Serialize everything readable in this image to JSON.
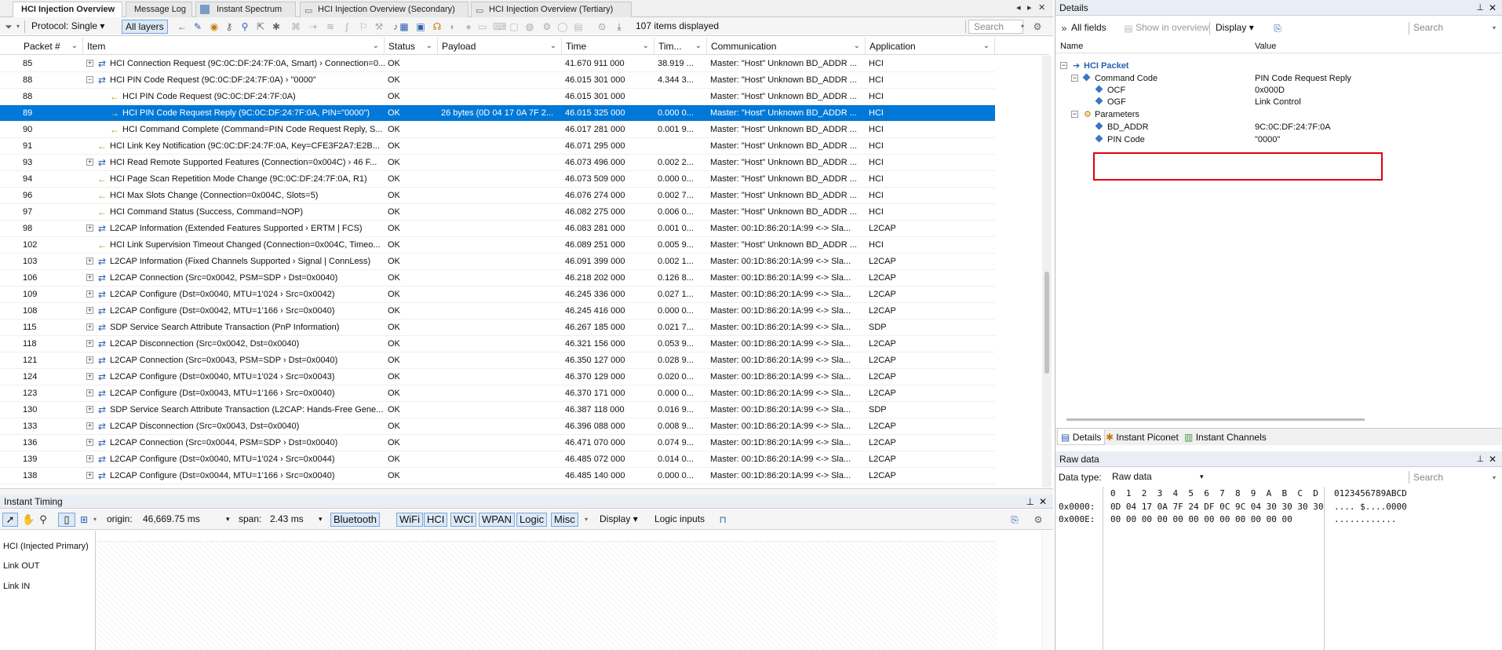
{
  "tabs": [
    {
      "label": "HCI Injection Overview",
      "active": true
    },
    {
      "label": "Message Log"
    },
    {
      "label": "Instant Spectrum"
    },
    {
      "label": "HCI Injection Overview (Secondary)"
    },
    {
      "label": "HCI Injection Overview (Tertiary)"
    }
  ],
  "toolbar": {
    "protocol": "Protocol: Single",
    "all_layers": "All layers",
    "items_displayed": "107 items displayed",
    "search_placeholder": "Search"
  },
  "columns": [
    "Packet #",
    "Item",
    "Status",
    "Payload",
    "Time",
    "Tim...",
    "Communication",
    "Application"
  ],
  "rows": [
    {
      "packet": "85",
      "item": "HCI Connection Request (9C:0C:DF:24:7F:0A, Smart) › Connection=0...",
      "status": "OK",
      "payload": "",
      "time": "41.670 911 000",
      "delta": "38.919 ...",
      "comm": "Master: \"Host\" Unknown BD_ADDR ...",
      "app": "HCI",
      "level": 0,
      "expand": "+",
      "icon": "⇄"
    },
    {
      "packet": "88",
      "item": "HCI PIN Code Request (9C:0C:DF:24:7F:0A) › \"0000\"",
      "status": "OK",
      "payload": "",
      "time": "46.015 301 000",
      "delta": "4.344 3...",
      "comm": "Master: \"Host\" Unknown BD_ADDR ...",
      "app": "HCI",
      "level": 0,
      "expand": "−",
      "icon": "⇄"
    },
    {
      "packet": "88",
      "item": "HCI PIN Code Request (9C:0C:DF:24:7F:0A)",
      "status": "OK",
      "payload": "",
      "time": "46.015 301 000",
      "delta": "",
      "comm": "Master: \"Host\" Unknown BD_ADDR ...",
      "app": "HCI",
      "level": 1,
      "expand": "",
      "icon": "←"
    },
    {
      "packet": "89",
      "item": "HCI PIN Code Request Reply (9C:0C:DF:24:7F:0A, PIN=\"0000\")",
      "status": "OK",
      "payload": "26 bytes (0D 04 17 0A 7F 2...",
      "time": "46.015 325 000",
      "delta": "0.000 0...",
      "comm": "Master: \"Host\" Unknown BD_ADDR ...",
      "app": "HCI",
      "level": 1,
      "expand": "",
      "icon": "→",
      "selected": true
    },
    {
      "packet": "90",
      "item": "HCI Command Complete (Command=PIN Code Request Reply, S...",
      "status": "OK",
      "payload": "",
      "time": "46.017 281 000",
      "delta": "0.001 9...",
      "comm": "Master: \"Host\" Unknown BD_ADDR ...",
      "app": "HCI",
      "level": 1,
      "expand": "",
      "icon": "←"
    },
    {
      "packet": "91",
      "item": "HCI Link Key Notification (9C:0C:DF:24:7F:0A, Key=CFE3F2A7:E2B...",
      "status": "OK",
      "payload": "",
      "time": "46.071 295 000",
      "delta": "",
      "comm": "Master: \"Host\" Unknown BD_ADDR ...",
      "app": "HCI",
      "level": 0,
      "expand": "",
      "icon": "←"
    },
    {
      "packet": "93",
      "item": "HCI Read Remote Supported Features (Connection=0x004C) › 46 F...",
      "status": "OK",
      "payload": "",
      "time": "46.073 496 000",
      "delta": "0.002 2...",
      "comm": "Master: \"Host\" Unknown BD_ADDR ...",
      "app": "HCI",
      "level": 0,
      "expand": "+",
      "icon": "⇄"
    },
    {
      "packet": "94",
      "item": "HCI Page Scan Repetition Mode Change (9C:0C:DF:24:7F:0A, R1)",
      "status": "OK",
      "payload": "",
      "time": "46.073 509 000",
      "delta": "0.000 0...",
      "comm": "Master: \"Host\" Unknown BD_ADDR ...",
      "app": "HCI",
      "level": 0,
      "expand": "",
      "icon": "←"
    },
    {
      "packet": "96",
      "item": "HCI Max Slots Change (Connection=0x004C, Slots=5)",
      "status": "OK",
      "payload": "",
      "time": "46.076 274 000",
      "delta": "0.002 7...",
      "comm": "Master: \"Host\" Unknown BD_ADDR ...",
      "app": "HCI",
      "level": 0,
      "expand": "",
      "icon": "←"
    },
    {
      "packet": "97",
      "item": "HCI Command Status (Success, Command=NOP)",
      "status": "OK",
      "payload": "",
      "time": "46.082 275 000",
      "delta": "0.006 0...",
      "comm": "Master: \"Host\" Unknown BD_ADDR ...",
      "app": "HCI",
      "level": 0,
      "expand": "",
      "icon": "←"
    },
    {
      "packet": "98",
      "item": "L2CAP Information (Extended Features Supported › ERTM | FCS)",
      "status": "OK",
      "payload": "",
      "time": "46.083 281 000",
      "delta": "0.001 0...",
      "comm": "Master: 00:1D:86:20:1A:99 <-> Sla...",
      "app": "L2CAP",
      "level": 0,
      "expand": "+",
      "icon": "⇄"
    },
    {
      "packet": "102",
      "item": "HCI Link Supervision Timeout Changed (Connection=0x004C, Timeo...",
      "status": "OK",
      "payload": "",
      "time": "46.089 251 000",
      "delta": "0.005 9...",
      "comm": "Master: \"Host\" Unknown BD_ADDR ...",
      "app": "HCI",
      "level": 0,
      "expand": "",
      "icon": "←"
    },
    {
      "packet": "103",
      "item": "L2CAP Information (Fixed Channels Supported › Signal | ConnLess)",
      "status": "OK",
      "payload": "",
      "time": "46.091 399 000",
      "delta": "0.002 1...",
      "comm": "Master: 00:1D:86:20:1A:99 <-> Sla...",
      "app": "L2CAP",
      "level": 0,
      "expand": "+",
      "icon": "⇄"
    },
    {
      "packet": "106",
      "item": "L2CAP Connection (Src=0x0042, PSM=SDP › Dst=0x0040)",
      "status": "OK",
      "payload": "",
      "time": "46.218 202 000",
      "delta": "0.126 8...",
      "comm": "Master: 00:1D:86:20:1A:99 <-> Sla...",
      "app": "L2CAP",
      "level": 0,
      "expand": "+",
      "icon": "⇄"
    },
    {
      "packet": "109",
      "item": "L2CAP Configure (Dst=0x0040, MTU=1'024 › Src=0x0042)",
      "status": "OK",
      "payload": "",
      "time": "46.245 336 000",
      "delta": "0.027 1...",
      "comm": "Master: 00:1D:86:20:1A:99 <-> Sla...",
      "app": "L2CAP",
      "level": 0,
      "expand": "+",
      "icon": "⇄"
    },
    {
      "packet": "108",
      "item": "L2CAP Configure (Dst=0x0042, MTU=1'166 › Src=0x0040)",
      "status": "OK",
      "payload": "",
      "time": "46.245 416 000",
      "delta": "0.000 0...",
      "comm": "Master: 00:1D:86:20:1A:99 <-> Sla...",
      "app": "L2CAP",
      "level": 0,
      "expand": "+",
      "icon": "⇄"
    },
    {
      "packet": "115",
      "item": "SDP Service Search Attribute Transaction (PnP Information)",
      "status": "OK",
      "payload": "",
      "time": "46.267 185 000",
      "delta": "0.021 7...",
      "comm": "Master: 00:1D:86:20:1A:99 <-> Sla...",
      "app": "SDP",
      "level": 0,
      "expand": "+",
      "icon": "⇄"
    },
    {
      "packet": "118",
      "item": "L2CAP Disconnection (Src=0x0042, Dst=0x0040)",
      "status": "OK",
      "payload": "",
      "time": "46.321 156 000",
      "delta": "0.053 9...",
      "comm": "Master: 00:1D:86:20:1A:99 <-> Sla...",
      "app": "L2CAP",
      "level": 0,
      "expand": "+",
      "icon": "⇄"
    },
    {
      "packet": "121",
      "item": "L2CAP Connection (Src=0x0043, PSM=SDP › Dst=0x0040)",
      "status": "OK",
      "payload": "",
      "time": "46.350 127 000",
      "delta": "0.028 9...",
      "comm": "Master: 00:1D:86:20:1A:99 <-> Sla...",
      "app": "L2CAP",
      "level": 0,
      "expand": "+",
      "icon": "⇄"
    },
    {
      "packet": "124",
      "item": "L2CAP Configure (Dst=0x0040, MTU=1'024 › Src=0x0043)",
      "status": "OK",
      "payload": "",
      "time": "46.370 129 000",
      "delta": "0.020 0...",
      "comm": "Master: 00:1D:86:20:1A:99 <-> Sla...",
      "app": "L2CAP",
      "level": 0,
      "expand": "+",
      "icon": "⇄"
    },
    {
      "packet": "123",
      "item": "L2CAP Configure (Dst=0x0043, MTU=1'166 › Src=0x0040)",
      "status": "OK",
      "payload": "",
      "time": "46.370 171 000",
      "delta": "0.000 0...",
      "comm": "Master: 00:1D:86:20:1A:99 <-> Sla...",
      "app": "L2CAP",
      "level": 0,
      "expand": "+",
      "icon": "⇄"
    },
    {
      "packet": "130",
      "item": "SDP Service Search Attribute Transaction (L2CAP: Hands-Free Gene...",
      "status": "OK",
      "payload": "",
      "time": "46.387 118 000",
      "delta": "0.016 9...",
      "comm": "Master: 00:1D:86:20:1A:99 <-> Sla...",
      "app": "SDP",
      "level": 0,
      "expand": "+",
      "icon": "⇄"
    },
    {
      "packet": "133",
      "item": "L2CAP Disconnection (Src=0x0043, Dst=0x0040)",
      "status": "OK",
      "payload": "",
      "time": "46.396 088 000",
      "delta": "0.008 9...",
      "comm": "Master: 00:1D:86:20:1A:99 <-> Sla...",
      "app": "L2CAP",
      "level": 0,
      "expand": "+",
      "icon": "⇄"
    },
    {
      "packet": "136",
      "item": "L2CAP Connection (Src=0x0044, PSM=SDP › Dst=0x0040)",
      "status": "OK",
      "payload": "",
      "time": "46.471 070 000",
      "delta": "0.074 9...",
      "comm": "Master: 00:1D:86:20:1A:99 <-> Sla...",
      "app": "L2CAP",
      "level": 0,
      "expand": "+",
      "icon": "⇄"
    },
    {
      "packet": "139",
      "item": "L2CAP Configure (Dst=0x0040, MTU=1'024 › Src=0x0044)",
      "status": "OK",
      "payload": "",
      "time": "46.485 072 000",
      "delta": "0.014 0...",
      "comm": "Master: 00:1D:86:20:1A:99 <-> Sla...",
      "app": "L2CAP",
      "level": 0,
      "expand": "+",
      "icon": "⇄"
    },
    {
      "packet": "138",
      "item": "L2CAP Configure (Dst=0x0044, MTU=1'166 › Src=0x0040)",
      "status": "OK",
      "payload": "",
      "time": "46.485 140 000",
      "delta": "0.000 0...",
      "comm": "Master: 00:1D:86:20:1A:99 <-> Sla...",
      "app": "L2CAP",
      "level": 0,
      "expand": "+",
      "icon": "⇄"
    }
  ],
  "timing": {
    "title": "Instant Timing",
    "origin_label": "origin:",
    "origin_value": "46,669.75 ms",
    "span_label": "span:",
    "span_value": "2.43 ms",
    "filters": [
      "Bluetooth",
      "WiFi",
      "HCI",
      "WCI",
      "WPAN",
      "Logic",
      "Misc"
    ],
    "display": "Display",
    "logic_inputs": "Logic inputs",
    "lanes": [
      "HCI (Injected Primary)",
      "Link OUT",
      "Link IN"
    ]
  },
  "details": {
    "title": "Details",
    "all_fields": "All fields",
    "show_overview": "Show in overview",
    "display": "Display",
    "search_placeholder": "Search",
    "col_name": "Name",
    "col_value": "Value",
    "root": "HCI Packet",
    "fields": [
      {
        "name": "Command Code",
        "value": "PIN Code Request Reply",
        "level": 1,
        "expand": "−"
      },
      {
        "name": "OCF",
        "value": "0x000D",
        "level": 2,
        "expand": ""
      },
      {
        "name": "OGF",
        "value": "Link Control",
        "level": 2,
        "expand": ""
      },
      {
        "name": "Parameters",
        "value": "",
        "level": 1,
        "expand": "−"
      },
      {
        "name": "BD_ADDR",
        "value": "9C:0C:DF:24:7F:0A",
        "level": 2,
        "expand": ""
      },
      {
        "name": "PIN Code",
        "value": "\"0000\"",
        "level": 2,
        "expand": ""
      }
    ],
    "bottom_tabs": [
      "Details",
      "Instant Piconet",
      "Instant Channels"
    ]
  },
  "raw": {
    "title": "Raw data",
    "data_type_label": "Data type:",
    "data_type_value": "Raw data",
    "search_placeholder": "Search",
    "hex_header": "0  1  2  3  4  5  6  7  8  9  A  B  C  D",
    "ascii_header": "0123456789ABCD",
    "lines": [
      {
        "addr": "0x0000:",
        "hex": "0D 04 17 0A 7F 24 DF 0C 9C 04 30 30 30 30",
        "ascii": ".... $....0000"
      },
      {
        "addr": "0x000E:",
        "hex": "00 00 00 00 00 00 00 00 00 00 00 00",
        "ascii": "............"
      }
    ]
  }
}
